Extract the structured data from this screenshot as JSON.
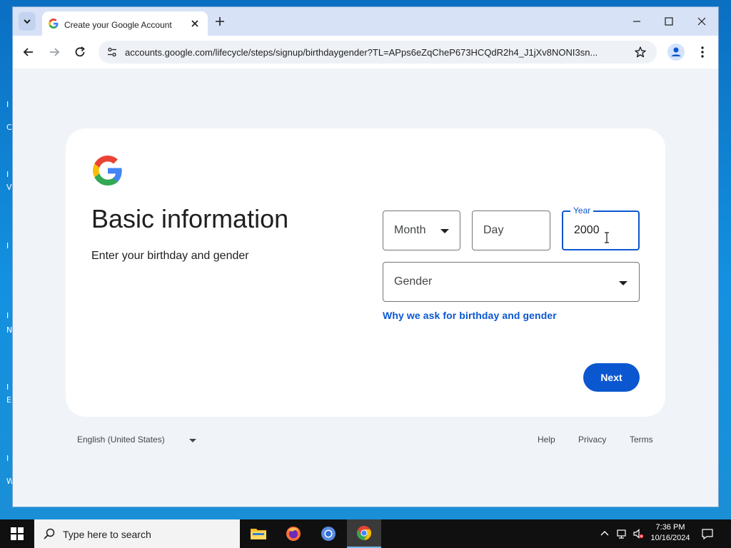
{
  "browser": {
    "tab_title": "Create your Google Account",
    "url": "accounts.google.com/lifecycle/steps/signup/birthdaygender?TL=APps6eZqCheP673HCQdR2h4_J1jXv8NONI3sn..."
  },
  "page": {
    "heading": "Basic information",
    "subheading": "Enter your birthday and gender",
    "month": {
      "placeholder": "Month"
    },
    "day": {
      "placeholder": "Day"
    },
    "year": {
      "label": "Year",
      "value": "2000"
    },
    "gender": {
      "placeholder": "Gender"
    },
    "why_link": "Why we ask for birthday and gender",
    "next_label": "Next"
  },
  "footer": {
    "language": "English (United States)",
    "links": {
      "help": "Help",
      "privacy": "Privacy",
      "terms": "Terms"
    }
  },
  "taskbar": {
    "search_placeholder": "Type here to search",
    "time": "7:36 PM",
    "date": "10/16/2024"
  },
  "colors": {
    "accent": "#0b57d0",
    "card_bg": "#ffffff",
    "page_bg": "#f0f4f9"
  }
}
